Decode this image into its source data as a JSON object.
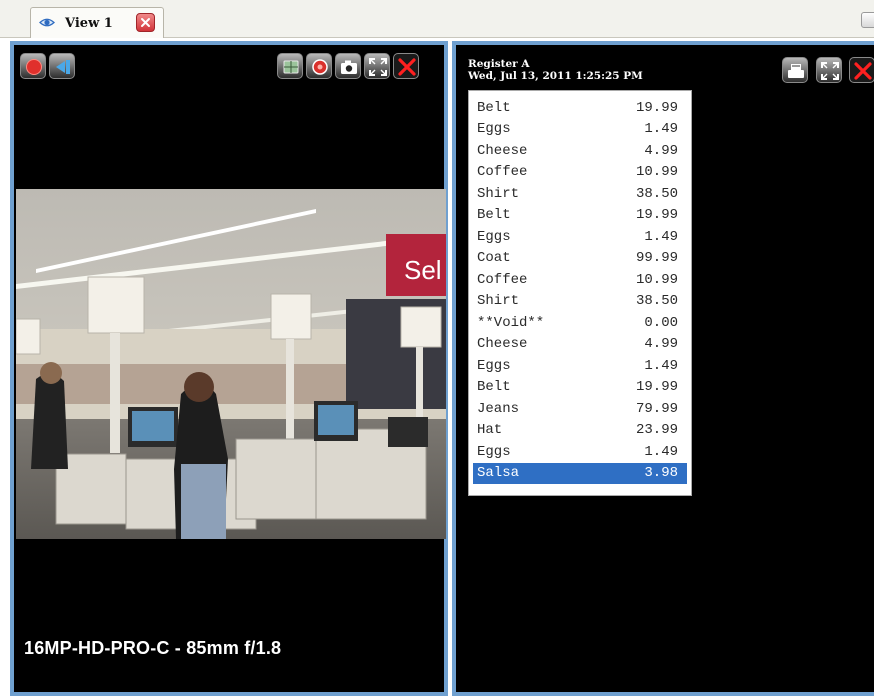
{
  "tab": {
    "label": "View 1"
  },
  "left_pane": {
    "camera_label": "16MP-HD-PRO-C - 85mm f/1.8",
    "image_store_sign": "Sel"
  },
  "right_pane": {
    "register_name": "Register A",
    "timestamp": "Wed, Jul 13, 2011 1:25:25 PM",
    "receipt_items": [
      {
        "name": "Belt",
        "price": "19.99"
      },
      {
        "name": "Eggs",
        "price": "1.49"
      },
      {
        "name": "Cheese",
        "price": "4.99"
      },
      {
        "name": "Coffee",
        "price": "10.99"
      },
      {
        "name": "Shirt",
        "price": "38.50"
      },
      {
        "name": "Belt",
        "price": "19.99"
      },
      {
        "name": "Eggs",
        "price": "1.49"
      },
      {
        "name": "Coat",
        "price": "99.99"
      },
      {
        "name": "Coffee",
        "price": "10.99"
      },
      {
        "name": "Shirt",
        "price": "38.50"
      },
      {
        "name": "**Void**",
        "price": "0.00"
      },
      {
        "name": "Cheese",
        "price": "4.99"
      },
      {
        "name": "Eggs",
        "price": "1.49"
      },
      {
        "name": "Belt",
        "price": "19.99"
      },
      {
        "name": "Jeans",
        "price": "79.99"
      },
      {
        "name": "Hat",
        "price": "23.99"
      },
      {
        "name": "Eggs",
        "price": "1.49"
      },
      {
        "name": "Salsa",
        "price": "3.98",
        "selected": true
      }
    ]
  },
  "colors": {
    "pane_border": "#6fa0d0",
    "selection": "#2f6fc4",
    "record_red": "#e0302c",
    "close_red": "#ff2020"
  },
  "icons": {
    "tab": [
      "eye-icon",
      "close-icon"
    ],
    "left_toolbar": [
      "record-icon",
      "playback-icon",
      "layout-icon",
      "alarm-icon",
      "snapshot-icon",
      "fullscreen-icon",
      "close-icon"
    ],
    "right_toolbar": [
      "pos-register-icon",
      "fullscreen-icon",
      "close-icon"
    ]
  }
}
